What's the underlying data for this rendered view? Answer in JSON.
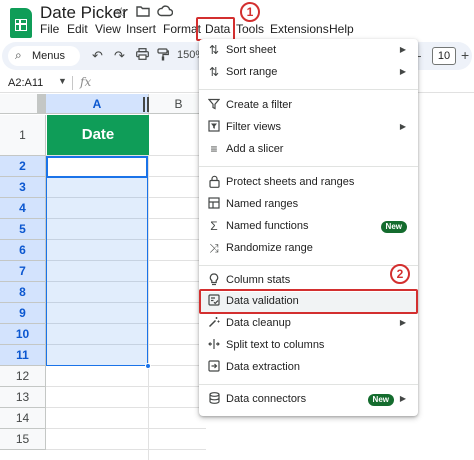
{
  "app": {
    "doc_title": "Date Picker",
    "title_icons": [
      "star-icon",
      "move-to-folder-icon",
      "cloud-status-icon"
    ],
    "menu": [
      "File",
      "Edit",
      "View",
      "Insert",
      "Format",
      "Data",
      "Tools",
      "Extensions",
      "Help"
    ],
    "highlighted_menu": "Data"
  },
  "annotations": {
    "step1": "1",
    "step2": "2",
    "highlight_color": "#d32f2f"
  },
  "toolbar": {
    "menus_label": "Menus",
    "zoom": "150%",
    "font_size": "10",
    "font_minus": "−",
    "font_plus": "+"
  },
  "formula_bar": {
    "name_box": "A2:A11",
    "fx": "fx"
  },
  "grid": {
    "columns": [
      "A",
      "B"
    ],
    "rows": [
      "1",
      "2",
      "3",
      "4",
      "5",
      "6",
      "7",
      "8",
      "9",
      "10",
      "11",
      "12",
      "13",
      "14",
      "15"
    ],
    "header_cell": "Date",
    "header_fill": "#0f9d58",
    "selection_range": "A2:A11"
  },
  "data_menu": {
    "items": [
      {
        "label": "Sort sheet",
        "icon": "sort-icon",
        "submenu": true
      },
      {
        "label": "Sort range",
        "icon": "sort-range-icon",
        "submenu": true
      },
      {
        "label": "Create a filter",
        "icon": "filter-icon"
      },
      {
        "label": "Filter views",
        "icon": "filter-views-icon",
        "submenu": true
      },
      {
        "label": "Add a slicer",
        "icon": "slicer-icon"
      },
      {
        "label": "Protect sheets and ranges",
        "icon": "lock-icon"
      },
      {
        "label": "Named ranges",
        "icon": "named-ranges-icon"
      },
      {
        "label": "Named functions",
        "icon": "sigma-icon",
        "badge": "New"
      },
      {
        "label": "Randomize range",
        "icon": "shuffle-icon"
      },
      {
        "label": "Column stats",
        "icon": "lightbulb-icon"
      },
      {
        "label": "Data validation",
        "icon": "data-validation-icon"
      },
      {
        "label": "Data cleanup",
        "icon": "magic-wand-icon",
        "submenu": true
      },
      {
        "label": "Split text to columns",
        "icon": "split-columns-icon"
      },
      {
        "label": "Data extraction",
        "icon": "extraction-icon"
      },
      {
        "label": "Data connectors",
        "icon": "database-icon",
        "badge": "New",
        "submenu": true
      }
    ]
  }
}
